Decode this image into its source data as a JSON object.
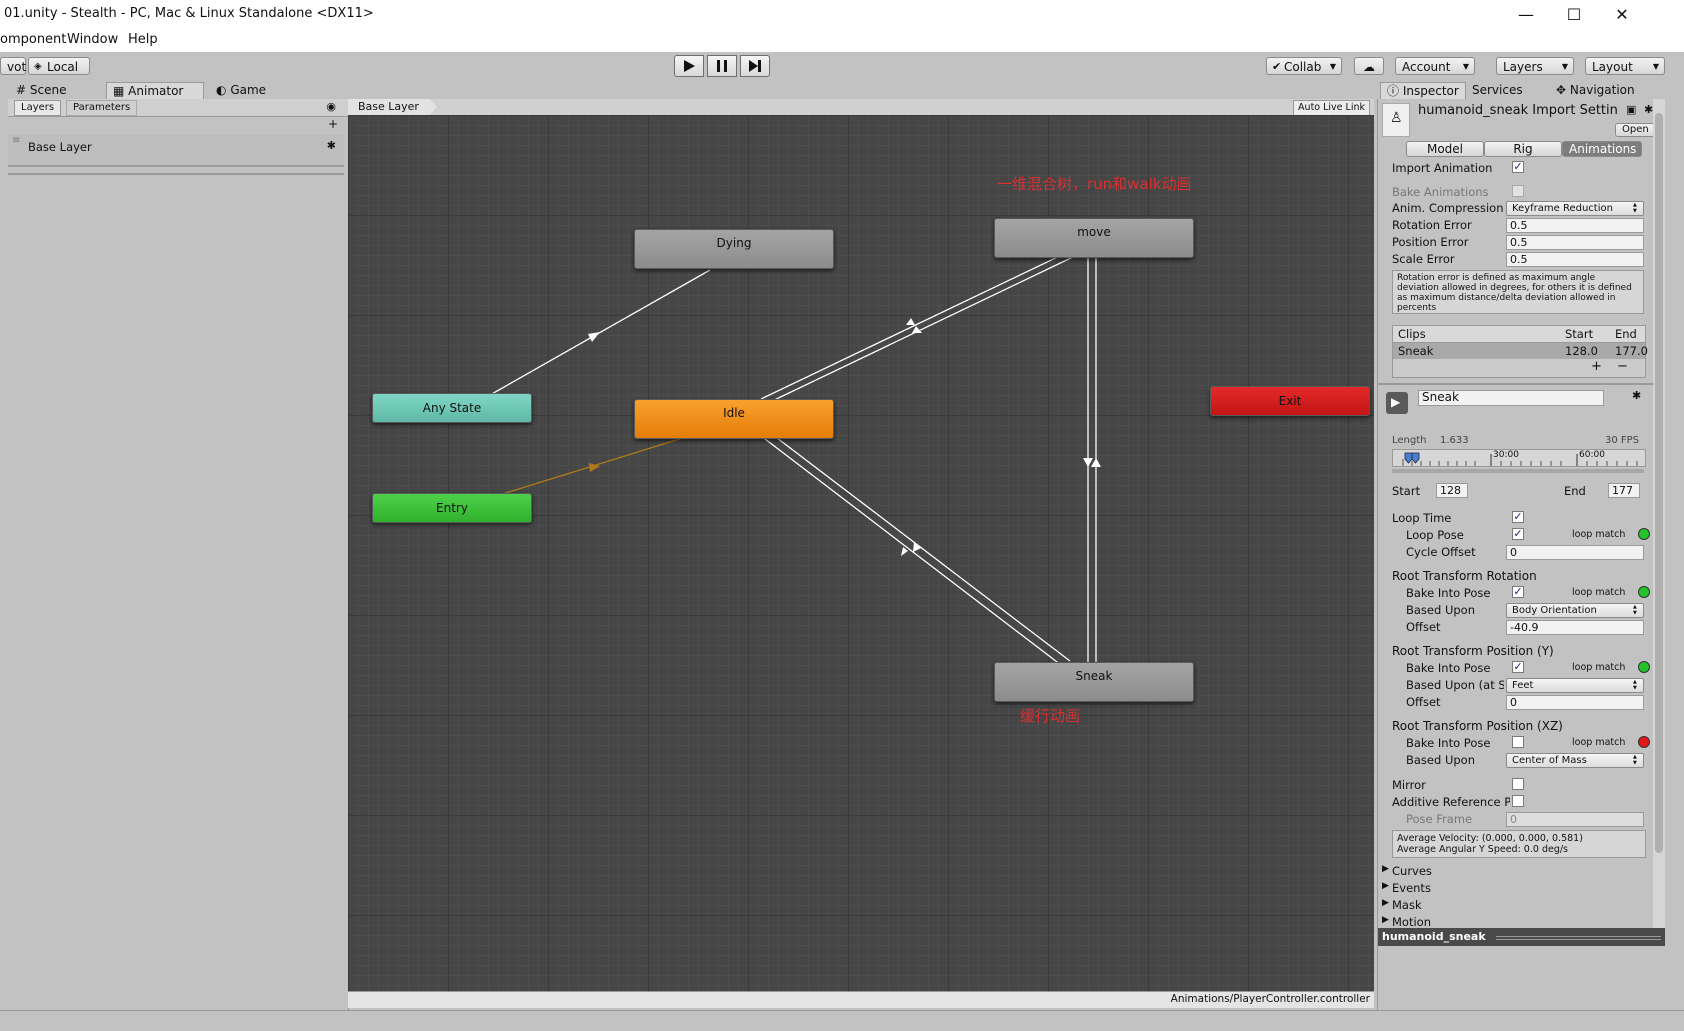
{
  "window": {
    "title": "01.unity - Stealth - PC, Mac & Linux Standalone <DX11>",
    "minimize_glyph": "—",
    "maximize_glyph": "☐",
    "close_glyph": "✕"
  },
  "menu": [
    "omponent",
    "Window",
    "Help"
  ],
  "toolbar": {
    "pivot_label": "vot",
    "local_label": "Local",
    "collab_label": "Collab",
    "account_label": "Account",
    "layers_label": "Layers",
    "layout_label": "Layout"
  },
  "tabs_left": {
    "scene": "Scene",
    "animator": "Animator",
    "game": "Game"
  },
  "animator": {
    "layers_tab": "Layers",
    "parameters_tab": "Parameters",
    "add_glyph": "+",
    "base_layer_item": "Base Layer",
    "breadcrumb": "Base Layer",
    "auto_live_link": "Auto Live Link",
    "nodes": {
      "dying": "Dying",
      "move": "move",
      "any_state": "Any State",
      "idle": "Idle",
      "exit": "Exit",
      "entry": "Entry",
      "sneak": "Sneak"
    },
    "note_move": "一维混合树，run和walk动画",
    "note_sneak": "缓行动画",
    "footer_path": "Animations/PlayerController.controller",
    "colors": {
      "idle": "#f08a12",
      "any_state": "#6fc7b4",
      "entry": "#3fc23a",
      "exit": "#d21e1e",
      "default": "#9a9a9a",
      "note": "#d83030"
    }
  },
  "tabs_right": {
    "inspector": "Inspector",
    "services": "Services",
    "navigation": "Navigation"
  },
  "inspector": {
    "title": "humanoid_sneak Import Settin",
    "open_button": "Open",
    "subtabs": [
      "Model",
      "Rig",
      "Animations"
    ],
    "import_animation_label": "Import Animation",
    "import_animation_checked": true,
    "bake_animations_label": "Bake Animations",
    "anim_compression_label": "Anim. Compression",
    "anim_compression_value": "Keyframe Reduction",
    "rotation_error_label": "Rotation Error",
    "rotation_error_value": "0.5",
    "position_error_label": "Position Error",
    "position_error_value": "0.5",
    "scale_error_label": "Scale Error",
    "scale_error_value": "0.5",
    "help_text": "Rotation error is defined as maximum angle deviation allowed in degrees, for others it is defined as maximum distance/delta deviation allowed in percents",
    "clips_header": {
      "clips": "Clips",
      "start": "Start",
      "end": "End"
    },
    "clips": [
      {
        "name": "Sneak",
        "start": "128.0",
        "end": "177.0"
      }
    ],
    "plus_glyph": "+",
    "minus_glyph": "−",
    "clip_name": "Sneak",
    "length_label": "Length",
    "length_value": "1.633",
    "fps": "30 FPS",
    "ruler_labels": [
      "30:00",
      "60:00"
    ],
    "start_label": "Start",
    "start_value": "128",
    "end_label": "End",
    "end_value": "177",
    "loop_time_label": "Loop Time",
    "loop_pose_label": "Loop Pose",
    "loop_match_label": "loop match",
    "cycle_offset_label": "Cycle Offset",
    "cycle_offset_value": "0",
    "root_rot_title": "Root Transform Rotation",
    "bake_into_pose_label": "Bake Into Pose",
    "based_upon_label": "Based Upon",
    "rot_based_upon_value": "Body Orientation",
    "offset_label": "Offset",
    "rot_offset_value": "-40.9",
    "root_pos_y_title": "Root Transform Position (Y)",
    "based_upon_at_start_label": "Based Upon (at St",
    "pos_y_based_upon_value": "Feet",
    "pos_y_offset_value": "0",
    "root_pos_xz_title": "Root Transform Position (XZ)",
    "pos_xz_based_upon_value": "Center of Mass",
    "mirror_label": "Mirror",
    "additive_label": "Additive Reference P",
    "pose_frame_label": "Pose Frame",
    "pose_frame_value": "0",
    "avg_velocity": "Average Velocity: (0.000, 0.000, 0.581)",
    "avg_angular": "Average Angular Y Speed: 0.0 deg/s",
    "foldouts": [
      "Curves",
      "Events",
      "Mask",
      "Motion"
    ],
    "preview_name": "humanoid_sneak",
    "loop_match_colors": [
      "#22c42a",
      "#22c42a",
      "#22c42a",
      "#e01818"
    ]
  }
}
